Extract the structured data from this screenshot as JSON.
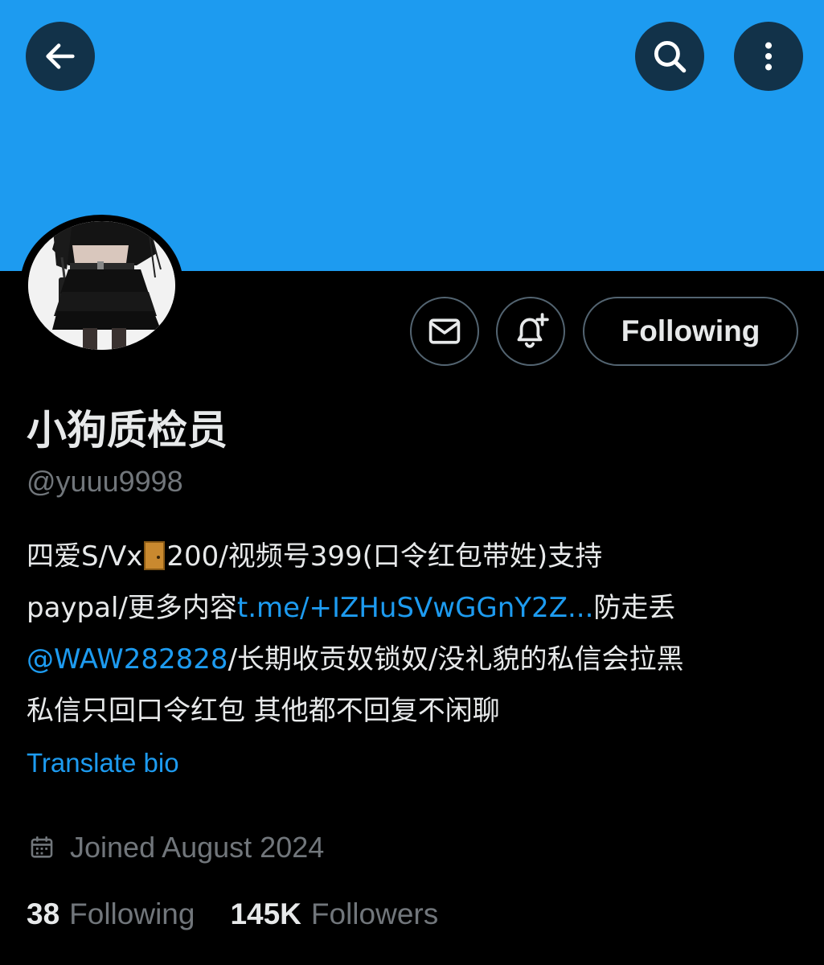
{
  "header": {
    "back_icon": "arrow-left-icon",
    "search_icon": "search-icon",
    "more_icon": "more-vertical-icon",
    "banner_color": "#1d9bf0"
  },
  "actions": {
    "message_icon": "envelope-icon",
    "notify_icon": "bell-plus-icon",
    "follow_label": "Following"
  },
  "profile": {
    "display_name": "小狗质检员",
    "handle": "@yuuu9998",
    "bio": {
      "line1_a": "四爱S/Vx",
      "line1_b": "200/视频号399(口令红包带姓)支持",
      "line2_a": "paypal/更多内容",
      "line2_link": "t.me/+IZHuSVwGGnY2Z...",
      "line2_b": "防走丢",
      "line3_mention": "@WAW282828",
      "line3_b": "/长期收贡奴锁奴/没礼貌的私信会拉黑",
      "line4": "私信只回口令红包 其他都不回复不闲聊"
    },
    "translate_label": "Translate bio",
    "joined": "Joined August 2024",
    "following_count": "38",
    "following_label": "Following",
    "followers_count": "145K",
    "followers_label": "Followers"
  },
  "colors": {
    "accent": "#1d9bf0",
    "text_primary": "#e7e9ea",
    "text_secondary": "#71767b",
    "background": "#000000"
  }
}
